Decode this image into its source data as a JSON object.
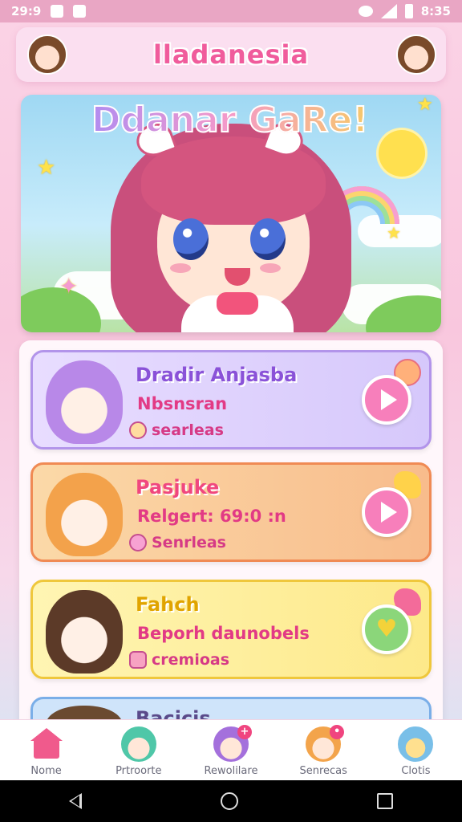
{
  "status_bar": {
    "time": "29:9",
    "clock": "8:35"
  },
  "header": {
    "title": "lladanesia"
  },
  "banner": {
    "title": "Ddanar GaRe!"
  },
  "cards": [
    {
      "title": "Dradir Anjasba",
      "subtitle": "Nbsnsran",
      "meta": "searleas"
    },
    {
      "title": "Pasjuke",
      "subtitle": "Relgert: 69:0 :n",
      "meta": "Senrleas"
    },
    {
      "title": "Fahch",
      "subtitle": "Beporh daunobels",
      "meta": "cremioas"
    },
    {
      "title": "Bacicis",
      "subtitle": "",
      "meta": ""
    }
  ],
  "bottom_nav": [
    {
      "label": "Nome",
      "icon": "home-icon"
    },
    {
      "label": "Prtroorte",
      "icon": "character-icon"
    },
    {
      "label": "Rewolilare",
      "icon": "character-icon"
    },
    {
      "label": "Senrecas",
      "icon": "character-icon"
    },
    {
      "label": "Clotis",
      "icon": "bird-icon"
    }
  ]
}
